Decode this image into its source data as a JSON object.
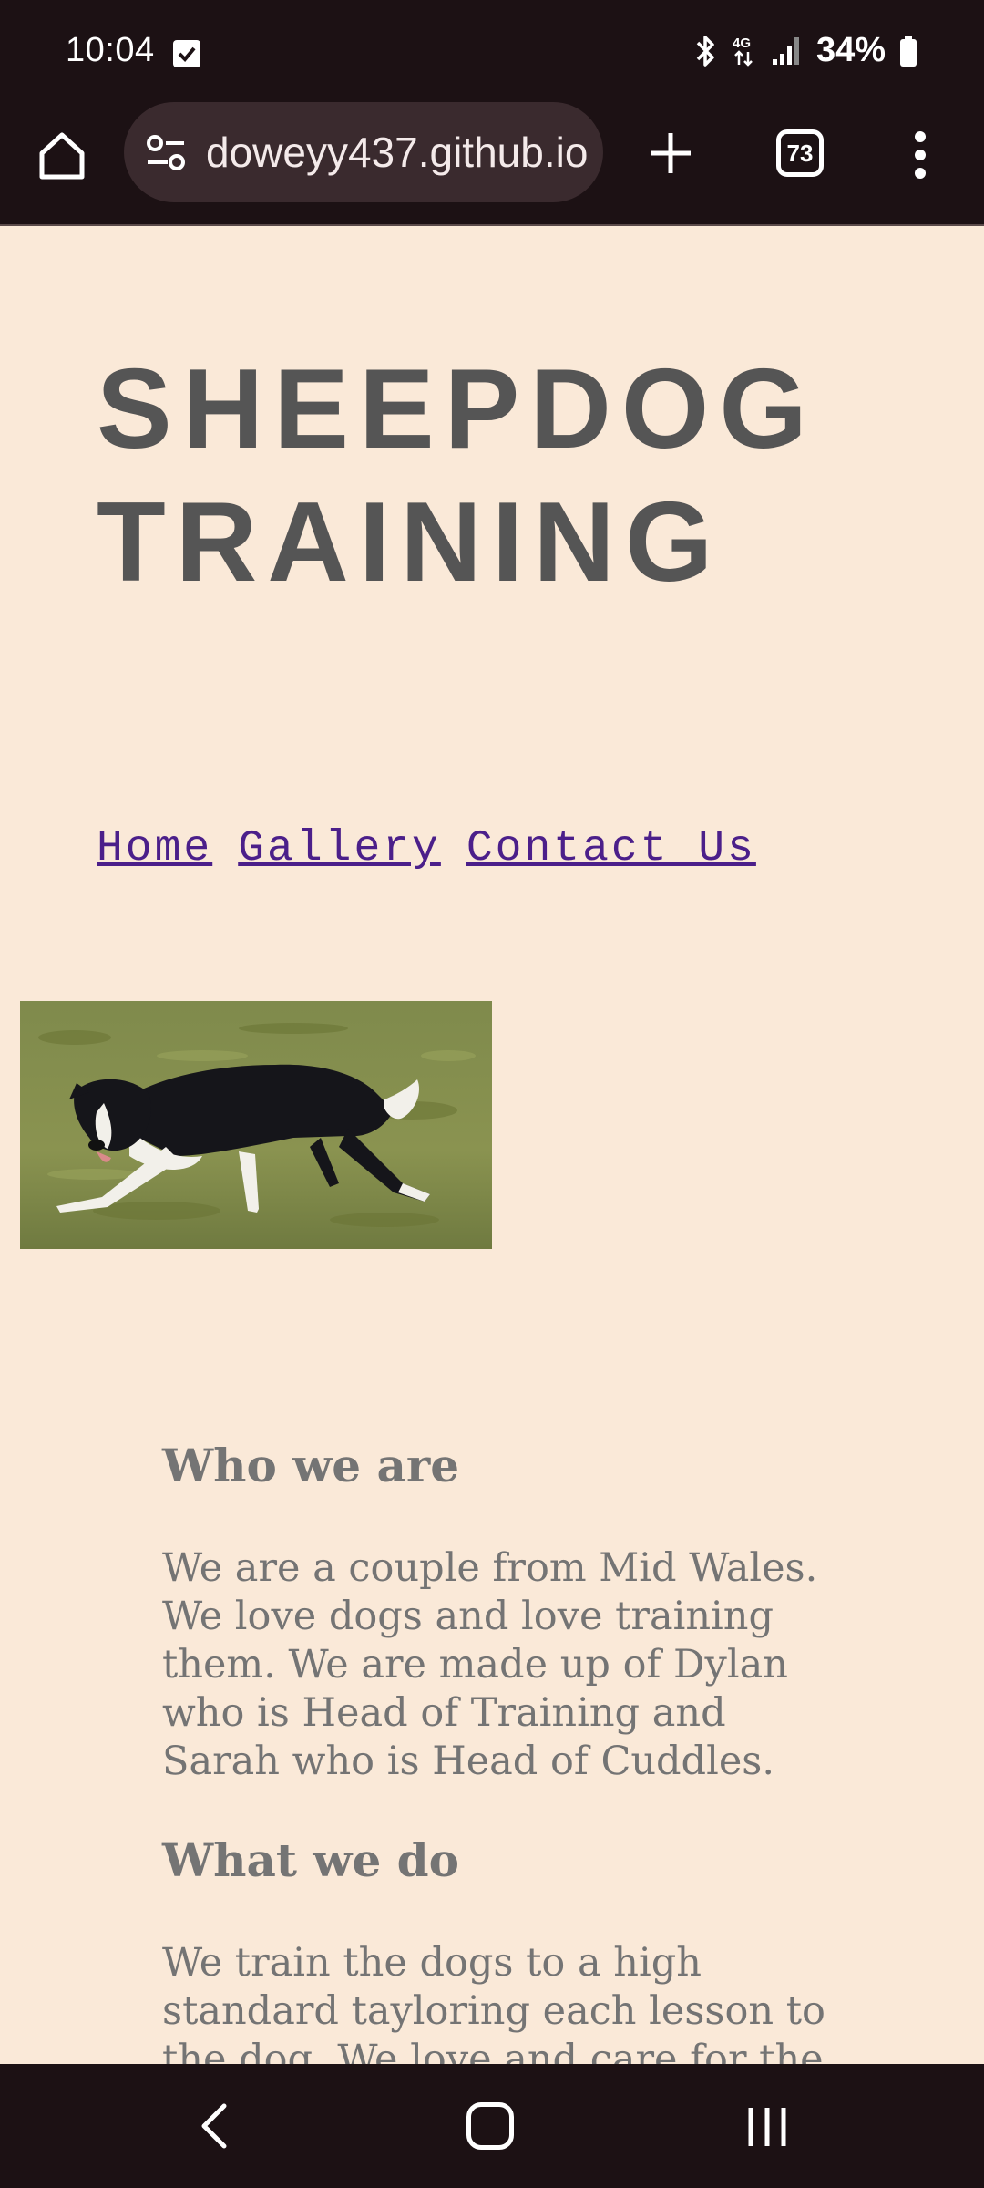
{
  "status_bar": {
    "time": "10:04",
    "battery": "34%",
    "network": "4G"
  },
  "browser": {
    "url": "doweyy437.github.io",
    "tab_count": "73"
  },
  "page": {
    "title_line1": "SHEEPDOG",
    "title_line2": "TRAINING",
    "nav": [
      "Home",
      "Gallery",
      "Contact Us"
    ],
    "sections": [
      {
        "heading": "Who we are",
        "body": "We are a couple from Mid Wales. We love dogs and love training them. We are made up of Dylan who is Head of Training and Sarah who is Head of Cuddles."
      },
      {
        "heading": "What we do",
        "body": "We train the dogs to a high standard tayloring each lesson to the dog. We love and care for the"
      }
    ]
  },
  "colors": {
    "page_background": "#fae9d8",
    "title": "#555555",
    "link": "#4b1f8a",
    "body_text": "#747474",
    "chrome": "#1c1114"
  },
  "icons": [
    "home-icon",
    "site-settings-icon",
    "new-tab-icon",
    "tab-switcher-icon",
    "more-menu-icon",
    "back-icon",
    "home-nav-icon",
    "recent-apps-icon",
    "bluetooth-icon",
    "signal-icon",
    "battery-icon"
  ]
}
